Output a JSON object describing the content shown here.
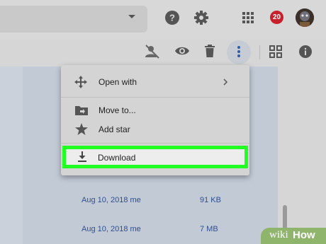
{
  "header": {
    "notification_count": "20",
    "icons": [
      "chevron-down-icon",
      "help-icon",
      "gear-icon",
      "apps-grid-icon",
      "avatar"
    ]
  },
  "toolbar": {
    "icons": [
      "share-off-icon",
      "preview-eye-icon",
      "trash-icon",
      "more-vert-icon",
      "grid-view-icon",
      "info-icon"
    ]
  },
  "menu": {
    "items": [
      {
        "label": "Open with",
        "icon": "open-with-icon",
        "has_submenu": true
      },
      {
        "label": "Move to...",
        "icon": "move-to-folder-icon"
      },
      {
        "label": "Add star",
        "icon": "star-icon"
      },
      {
        "label": "Download",
        "icon": "download-icon",
        "highlighted": true
      }
    ],
    "highlight_color": "#22ff22"
  },
  "files": [
    {
      "modified": "Aug 10, 2018 me",
      "size": "91 KB"
    },
    {
      "modified": "Aug 10, 2018 me",
      "size": "7 MB"
    }
  ],
  "watermark": {
    "part1": "wiki",
    "part2": "How"
  }
}
